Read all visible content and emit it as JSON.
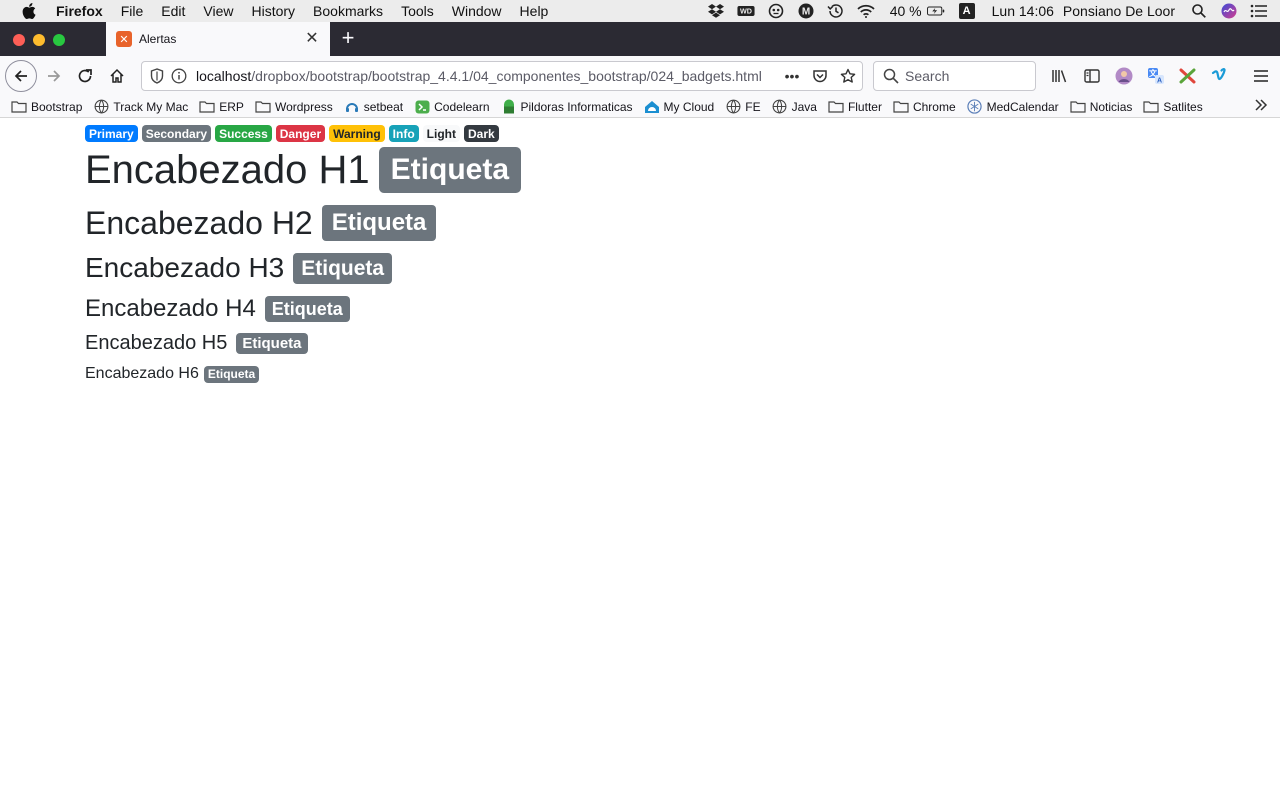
{
  "menubar": {
    "app_name": "Firefox",
    "items": [
      "File",
      "Edit",
      "View",
      "History",
      "Bookmarks",
      "Tools",
      "Window",
      "Help"
    ],
    "battery": "40 %",
    "input_source": "A",
    "clock": "Lun 14:06",
    "user": "Ponsiano De Loor"
  },
  "tab": {
    "title": "Alertas",
    "favicon_letter": "✕"
  },
  "urlbar": {
    "host": "localhost",
    "path": "/dropbox/bootstrap/bootstrap_4.4.1/04_componentes_bootstrap/024_badgets.html"
  },
  "search": {
    "placeholder": "Search"
  },
  "bookmarks": [
    {
      "label": "Bootstrap",
      "icon": "folder-icon"
    },
    {
      "label": "Track My Mac",
      "icon": "globe-icon"
    },
    {
      "label": "ERP",
      "icon": "folder-icon"
    },
    {
      "label": "Wordpress",
      "icon": "folder-icon"
    },
    {
      "label": "setbeat",
      "icon": "setbeat-icon"
    },
    {
      "label": "Codelearn",
      "icon": "codelearn-icon"
    },
    {
      "label": "Pildoras Informaticas",
      "icon": "pildoras-icon"
    },
    {
      "label": "My Cloud",
      "icon": "cloud-icon"
    },
    {
      "label": "FE",
      "icon": "globe-icon"
    },
    {
      "label": "Java",
      "icon": "globe-icon"
    },
    {
      "label": "Flutter",
      "icon": "folder-icon"
    },
    {
      "label": "Chrome",
      "icon": "folder-icon"
    },
    {
      "label": "MedCalendar",
      "icon": "medcalendar-icon"
    },
    {
      "label": "Noticias",
      "icon": "folder-icon"
    },
    {
      "label": "Satlites",
      "icon": "folder-icon"
    }
  ],
  "content": {
    "badges": {
      "primary": "Primary",
      "secondary": "Secondary",
      "success": "Success",
      "danger": "Danger",
      "warning": "Warning",
      "info": "Info",
      "light": "Light",
      "dark": "Dark"
    },
    "headings": {
      "h1": "Encabezado H1",
      "h2": "Encabezado H2",
      "h3": "Encabezado H3",
      "h4": "Encabezado H4",
      "h5": "Encabezado H5",
      "h6": "Encabezado H6"
    },
    "badge_label": "Etiqueta"
  },
  "colors": {
    "primary": "#007bff",
    "secondary": "#6c757d",
    "success": "#28a745",
    "danger": "#dc3545",
    "warning": "#ffc107",
    "info": "#17a2b8",
    "light": "#f8f9fa",
    "dark": "#343a40"
  }
}
